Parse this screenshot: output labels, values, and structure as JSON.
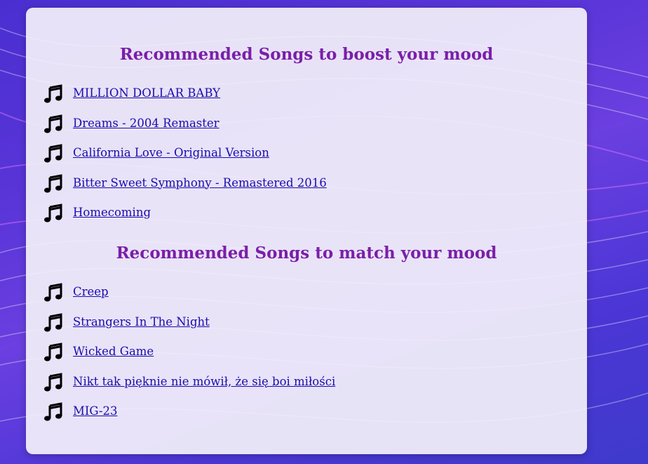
{
  "colors": {
    "title": "#7a1fa8",
    "link": "#1a0dab",
    "background": "#5a35d8",
    "card": "#f3f0fa"
  },
  "boost": {
    "title": "Recommended Songs to boost your mood",
    "icon": "music-note-icon",
    "songs": [
      "MILLION DOLLAR BABY",
      "Dreams - 2004 Remaster",
      "California Love - Original Version",
      "Bitter Sweet Symphony - Remastered 2016",
      "Homecoming"
    ]
  },
  "match": {
    "title": "Recommended Songs to match your mood",
    "icon": "music-note-icon",
    "songs": [
      "Creep",
      "Strangers In The Night",
      "Wicked Game",
      "Nikt tak pięknie nie mówił, że się boi miłości",
      "MIG-23"
    ]
  }
}
